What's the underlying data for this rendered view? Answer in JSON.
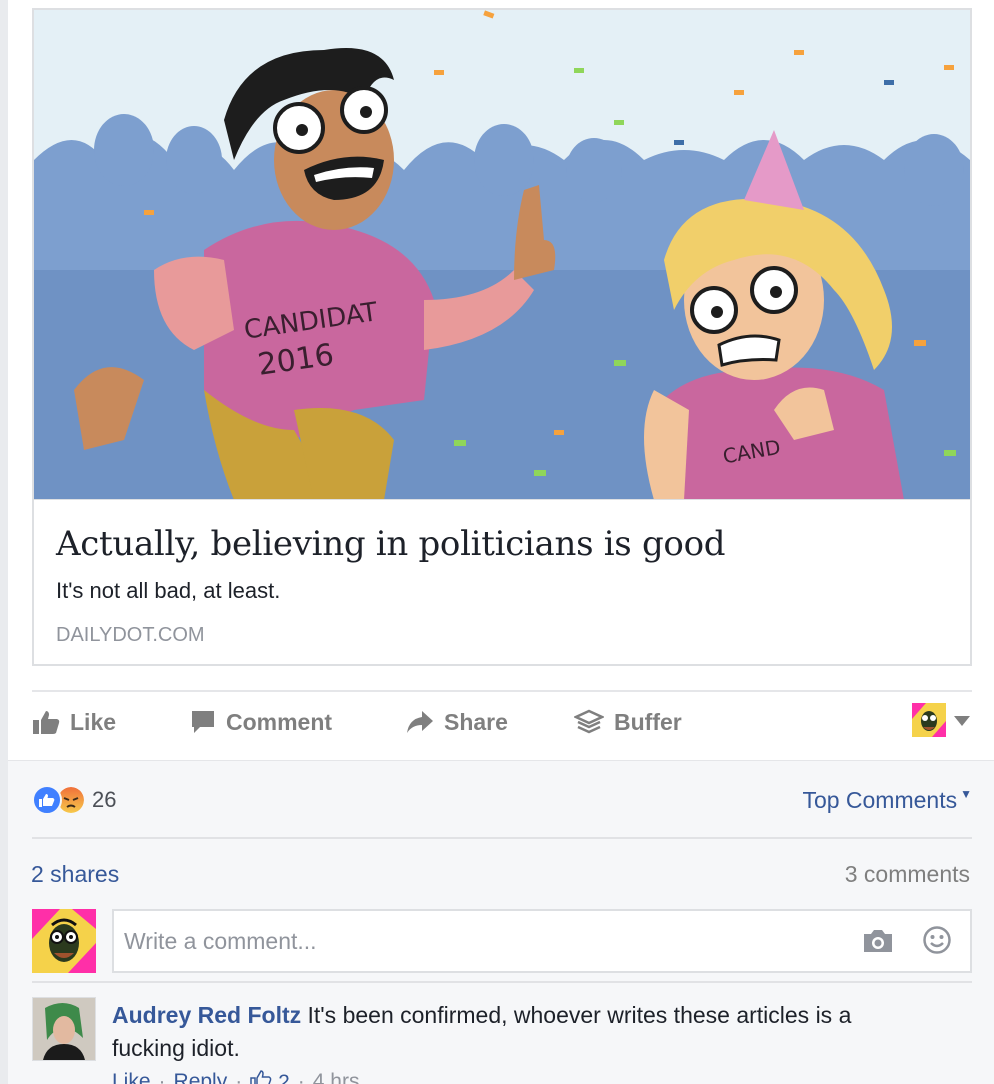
{
  "link_preview": {
    "title": "Actually, believing in politicians is good",
    "description": "It's not all bad, at least.",
    "domain": "DAILYDOT.COM",
    "image_text": {
      "shirt_left_line1": "CANDIDAT",
      "shirt_left_line2": "2016",
      "shirt_right": "CAND"
    }
  },
  "actions": {
    "like": "Like",
    "comment": "Comment",
    "share": "Share",
    "buffer": "Buffer"
  },
  "reactions": {
    "count": "26",
    "types": [
      "like",
      "angry"
    ]
  },
  "sort": {
    "label": "Top Comments"
  },
  "stats": {
    "shares": "2 shares",
    "comments": "3 comments"
  },
  "comment_input": {
    "placeholder": "Write a comment..."
  },
  "comments": [
    {
      "author": "Audrey Red Foltz",
      "text": "It's been confirmed, whoever writes these articles is a fucking idiot.",
      "actions": [
        "Like",
        "Reply"
      ],
      "likes": "2",
      "time": "4 hrs"
    }
  ],
  "colors": {
    "link": "#365899",
    "muted": "#90949c",
    "action_gray": "#7f7f7f",
    "background_gray": "#f6f7f9",
    "like_blue": "#4080ff",
    "angry_orange": "#f0703a"
  },
  "icons": [
    "thumbs-up-icon",
    "speech-bubble-icon",
    "share-arrow-icon",
    "buffer-stack-icon",
    "chevron-down-icon",
    "camera-icon",
    "smiley-icon"
  ]
}
